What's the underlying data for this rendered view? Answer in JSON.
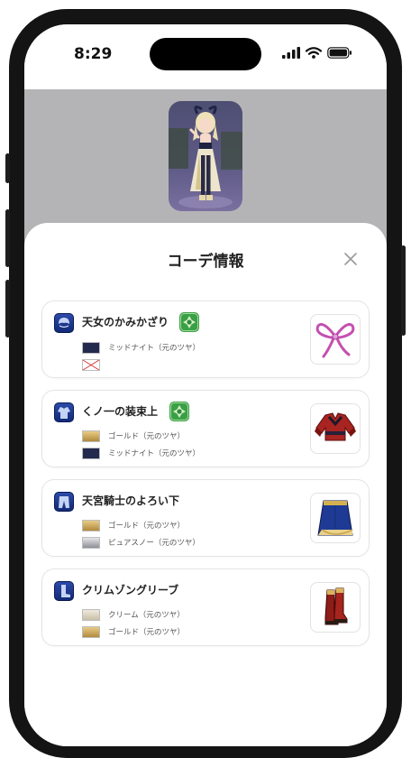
{
  "status_bar": {
    "time": "8:29"
  },
  "sheet": {
    "title": "コーデ情報"
  },
  "items": [
    {
      "name": "天女のかみかざり",
      "slot_icon": "head-slot-icon",
      "image_icon": "pink-ribbon-icon",
      "dyes": [
        {
          "label": "ミッドナイト（元のツヤ）",
          "swatch": "#222a4e"
        },
        {
          "label": "",
          "swatch": "none"
        }
      ]
    },
    {
      "name": "くノ一の装束上",
      "slot_icon": "body-top-slot-icon",
      "image_icon": "red-jacket-icon",
      "dyes": [
        {
          "label": "ゴールド（元のツヤ）",
          "swatch": "#c8a455"
        },
        {
          "label": "ミッドナイト（元のツヤ）",
          "swatch": "#222a4e"
        }
      ]
    },
    {
      "name": "天宮騎士のよろい下",
      "slot_icon": "body-bottom-slot-icon",
      "image_icon": "blue-skirt-icon",
      "dyes": [
        {
          "label": "ゴールド（元のツヤ）",
          "swatch": "#c8a455"
        },
        {
          "label": "ピュアスノー（元のツヤ）",
          "swatch": "#b9b9be"
        }
      ]
    },
    {
      "name": "クリムゾングリーブ",
      "slot_icon": "leg-slot-icon",
      "image_icon": "crimson-boots-icon",
      "dyes": [
        {
          "label": "クリーム（元のツヤ）",
          "swatch": "#ddd6c6"
        },
        {
          "label": "ゴールド（元のツヤ）",
          "swatch": "#c8a455"
        }
      ]
    }
  ],
  "icons": {
    "close": "close-icon",
    "dye_badge": "green-dye-badge-icon",
    "no_dye": "no-dye-icon"
  },
  "colors": {
    "dye_badge_green": "#3aa048",
    "slot_icon_blue": "#1e3c94",
    "backdrop_gray": "#b4b4b6"
  }
}
